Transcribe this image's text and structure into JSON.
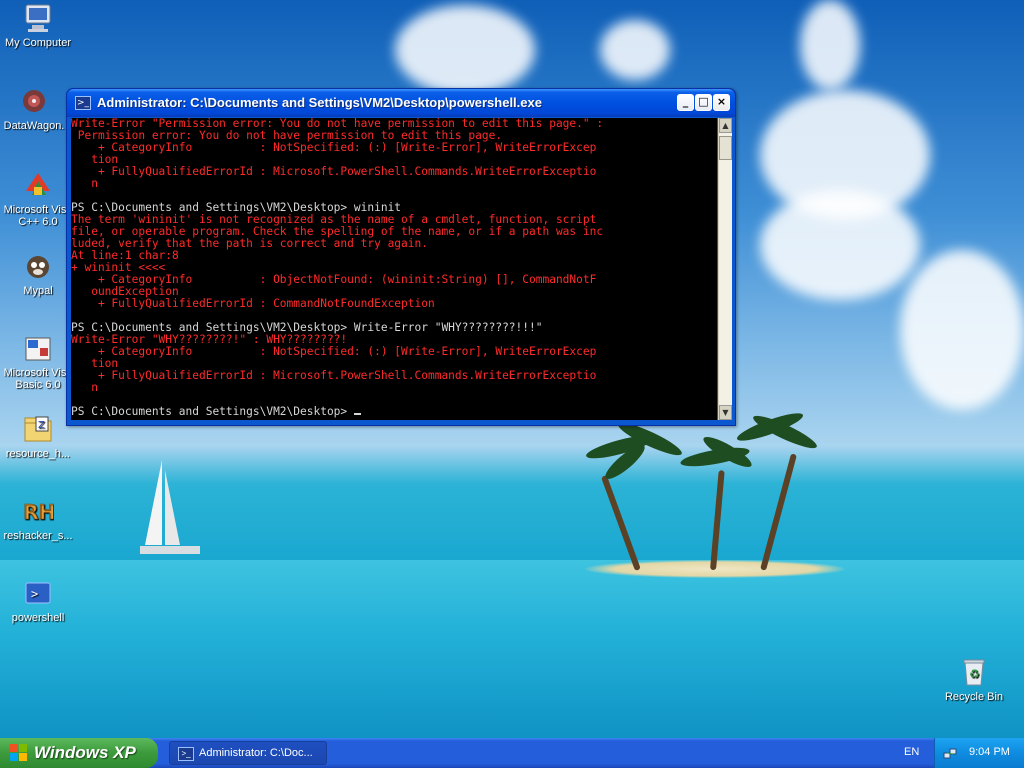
{
  "desktop": {
    "icons": [
      {
        "label": "My Computer"
      },
      {
        "label": "DataWagon."
      },
      {
        "label": "Microsoft Visu",
        "label2": "C++ 6.0"
      },
      {
        "label": "Mypal"
      },
      {
        "label": "Microsoft Visu",
        "label2": "Basic 6.0"
      },
      {
        "label": "resource_h..."
      },
      {
        "label": "reshacker_s..."
      },
      {
        "label": "powershell"
      },
      {
        "label": "Recycle Bin"
      }
    ]
  },
  "window": {
    "title": "Administrator: C:\\Documents and Settings\\VM2\\Desktop\\powershell.exe",
    "icon_glyph": ">_",
    "controls": {
      "minimize": "_",
      "maximize": "□",
      "close": "×"
    },
    "console_lines": [
      {
        "text": "Write-Error \"Permission error: You do not have permission to edit this page.\" :",
        "color": "red"
      },
      {
        "text": " Permission error: You do not have permission to edit this page.",
        "color": "red"
      },
      {
        "text": "    + CategoryInfo          : NotSpecified: (:) [Write-Error], WriteErrorExcep",
        "color": "red"
      },
      {
        "text": "   tion",
        "color": "red"
      },
      {
        "text": "    + FullyQualifiedErrorId : Microsoft.PowerShell.Commands.WriteErrorExceptio",
        "color": "red"
      },
      {
        "text": "   n",
        "color": "red"
      },
      {
        "text": "",
        "color": "gray"
      },
      {
        "text": "PS C:\\Documents and Settings\\VM2\\Desktop> wininit",
        "color": "gray"
      },
      {
        "text": "The term 'wininit' is not recognized as the name of a cmdlet, function, script",
        "color": "red"
      },
      {
        "text": "file, or operable program. Check the spelling of the name, or if a path was inc",
        "color": "red"
      },
      {
        "text": "luded, verify that the path is correct and try again.",
        "color": "red"
      },
      {
        "text": "At line:1 char:8",
        "color": "red"
      },
      {
        "text": "+ wininit <<<<",
        "color": "red"
      },
      {
        "text": "    + CategoryInfo          : ObjectNotFound: (wininit:String) [], CommandNotF",
        "color": "red"
      },
      {
        "text": "   oundException",
        "color": "red"
      },
      {
        "text": "    + FullyQualifiedErrorId : CommandNotFoundException",
        "color": "red"
      },
      {
        "text": "",
        "color": "gray"
      },
      {
        "text": "PS C:\\Documents and Settings\\VM2\\Desktop> Write-Error \"WHY????????!!!\"",
        "color": "gray"
      },
      {
        "text": "Write-Error \"WHY????????!\" : WHY????????!",
        "color": "red"
      },
      {
        "text": "    + CategoryInfo          : NotSpecified: (:) [Write-Error], WriteErrorExcep",
        "color": "red"
      },
      {
        "text": "   tion",
        "color": "red"
      },
      {
        "text": "    + FullyQualifiedErrorId : Microsoft.PowerShell.Commands.WriteErrorExceptio",
        "color": "red"
      },
      {
        "text": "   n",
        "color": "red"
      },
      {
        "text": "",
        "color": "gray"
      }
    ],
    "prompt": "PS C:\\Documents and Settings\\VM2\\Desktop> "
  },
  "taskbar": {
    "start_label": "Windows XP",
    "task_label": "Administrator: C:\\Doc...",
    "language": "EN",
    "clock": "9:04 PM"
  },
  "colors": {
    "console_bg": "#000000",
    "error_text": "#ff2a2a",
    "prompt_text": "#d6d6d6",
    "titlebar": "#0050e0",
    "taskbar": "#245edb",
    "start_button": "#3c9a3c"
  }
}
